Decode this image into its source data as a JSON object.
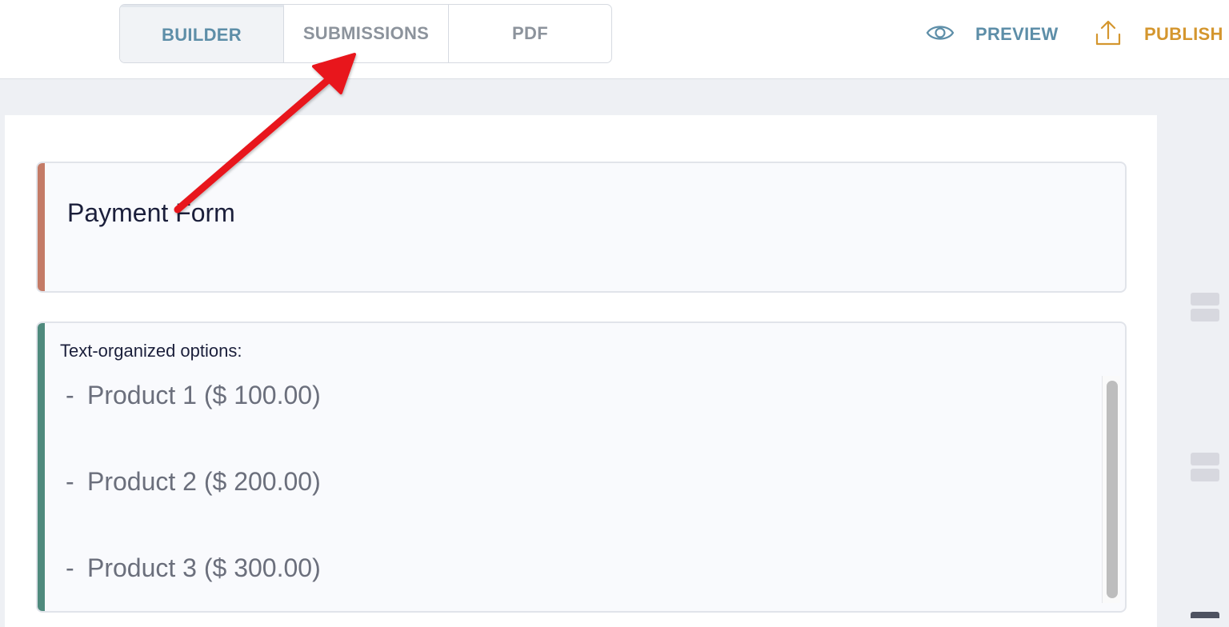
{
  "header": {
    "tabs": [
      {
        "label": "BUILDER",
        "active": true
      },
      {
        "label": "SUBMISSIONS",
        "active": false
      },
      {
        "label": "PDF",
        "active": false
      }
    ],
    "actions": {
      "preview": {
        "label": "PREVIEW",
        "icon": "eye-icon",
        "color": "#5d8ea8"
      },
      "publish": {
        "label": "PUBLISH",
        "icon": "upload-icon",
        "color": "#d4962e"
      }
    }
  },
  "form": {
    "title_block": {
      "title": "Payment Form",
      "accent_color": "#c47b67"
    },
    "options_block": {
      "label": "Text-organized options:",
      "accent_color": "#4f8a7d",
      "options": [
        {
          "dash": "-",
          "text": "Product 1 ($ 100.00)"
        },
        {
          "dash": "-",
          "text": "Product 2 ($ 200.00)"
        },
        {
          "dash": "-",
          "text": "Product 3 ($ 300.00)"
        }
      ]
    }
  },
  "annotation": {
    "arrow_color": "#e8141b",
    "points_to": "tab-submissions"
  }
}
